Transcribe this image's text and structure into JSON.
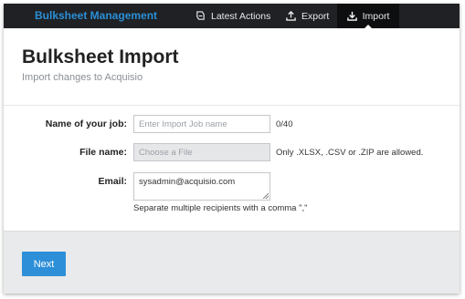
{
  "nav": {
    "brand": "Bulksheet Management",
    "items": [
      {
        "label": "Latest Actions",
        "icon": "latest-actions-icon"
      },
      {
        "label": "Export",
        "icon": "export-icon"
      },
      {
        "label": "Import",
        "icon": "import-icon",
        "active": true
      }
    ]
  },
  "header": {
    "title": "Bulksheet Import",
    "subtitle": "Import changes to Acquisio"
  },
  "form": {
    "job_name": {
      "label": "Name of your job:",
      "placeholder": "Enter Import Job name",
      "counter": "0/40"
    },
    "file": {
      "label": "File name:",
      "placeholder": "Choose a File",
      "hint": "Only .XLSX, .CSV or .ZIP are allowed."
    },
    "email": {
      "label": "Email:",
      "value": "sysadmin@acquisio.com",
      "hint": "Separate multiple recipients with a comma \",\""
    }
  },
  "footer": {
    "next_label": "Next"
  },
  "colors": {
    "accent": "#2d8fd8",
    "brand": "#2b8fd6",
    "topbar": "#1f2124"
  }
}
